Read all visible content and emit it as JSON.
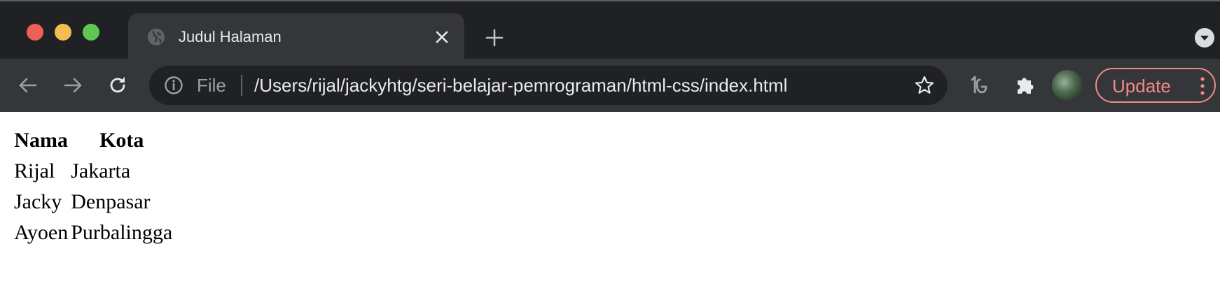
{
  "tab": {
    "title": "Judul Halaman"
  },
  "omnibox": {
    "scheme_label": "File",
    "url": "/Users/rijal/jackyhtg/seri-belajar-pemrograman/html-css/index.html"
  },
  "toolbar": {
    "update_label": "Update"
  },
  "table": {
    "headers": [
      "Nama",
      "Kota"
    ],
    "rows": [
      [
        "Rijal",
        "Jakarta"
      ],
      [
        "Jacky",
        "Denpasar"
      ],
      [
        "Ayoen",
        "Purbalingga"
      ]
    ]
  },
  "colors": {
    "tabstrip": "#202124",
    "toolbar": "#35363a",
    "update_accent": "#f28b82"
  }
}
